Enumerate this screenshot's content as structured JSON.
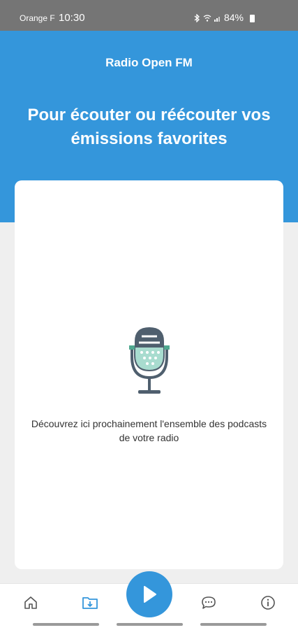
{
  "status_bar": {
    "carrier": "Orange F",
    "time": "10:30",
    "battery": "84%",
    "icons": [
      "bluetooth-icon",
      "wifi-icon",
      "signal-icon",
      "battery-icon"
    ]
  },
  "header": {
    "app_name": "Radio Open FM",
    "headline": "Pour écouter ou réécouter vos émissions favorites"
  },
  "content": {
    "icon": "microphone-icon",
    "message": "Découvrez ici prochainement l'ensemble des podcasts de votre radio"
  },
  "bottom_nav": {
    "items": [
      {
        "icon": "home-icon",
        "active": false
      },
      {
        "icon": "podcast-download-icon",
        "active": true
      },
      {
        "icon": "play-icon",
        "active": false
      },
      {
        "icon": "chat-icon",
        "active": false
      },
      {
        "icon": "info-icon",
        "active": false
      }
    ]
  },
  "colors": {
    "primary": "#3496db",
    "status_bar": "#757575",
    "background": "#efefef",
    "inactive_icon": "#555555",
    "mic_accent": "#a8dccf"
  }
}
